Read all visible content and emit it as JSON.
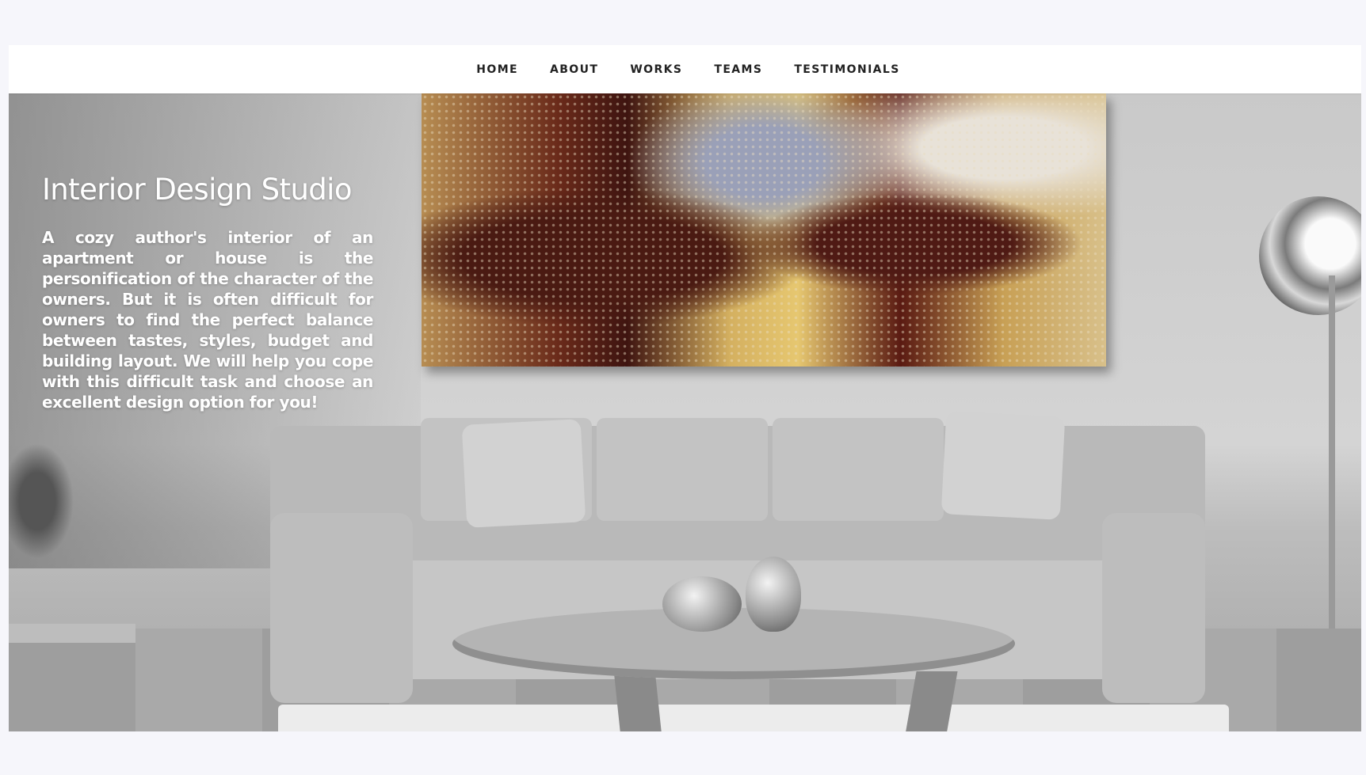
{
  "nav": {
    "items": [
      "HOME",
      "ABOUT",
      "WORKS",
      "TEAMS",
      "TESTIMONIALS"
    ]
  },
  "hero": {
    "title": "Interior Design Studio",
    "description": "A cozy author's interior of an apartment or house is the personification of the character of the owners. But it is often difficult for owners to find the perfect balance between tastes, styles, budget and building layout. We will help you cope with this difficult task and choose an excellent design option for you!"
  },
  "colors": {
    "page_background": "#f6f6fb",
    "navbar_background": "#ffffff",
    "nav_text": "#222222",
    "hero_text": "#ffffff"
  }
}
